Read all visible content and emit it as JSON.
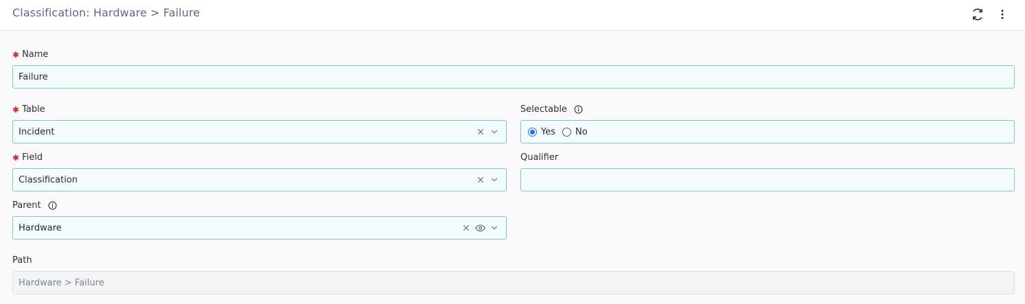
{
  "header": {
    "title": "Classification: Hardware > Failure",
    "refresh_icon": "refresh-icon",
    "menu_icon": "more-vert-icon"
  },
  "form": {
    "name": {
      "label": "Name",
      "required": true,
      "value": "Failure"
    },
    "table": {
      "label": "Table",
      "required": true,
      "value": "Incident"
    },
    "selectable": {
      "label": "Selectable",
      "options": [
        "Yes",
        "No"
      ],
      "selected": "Yes"
    },
    "field": {
      "label": "Field",
      "required": true,
      "value": "Classification"
    },
    "qualifier": {
      "label": "Qualifier",
      "value": ""
    },
    "parent": {
      "label": "Parent",
      "value": "Hardware"
    },
    "path": {
      "label": "Path",
      "value": "Hardware > Failure"
    }
  },
  "colors": {
    "accent_border": "#7cc6cf",
    "field_bg": "#f4fbfc",
    "required": "#c62828",
    "radio_selected": "#1a73e8",
    "title": "#5b6b88"
  }
}
